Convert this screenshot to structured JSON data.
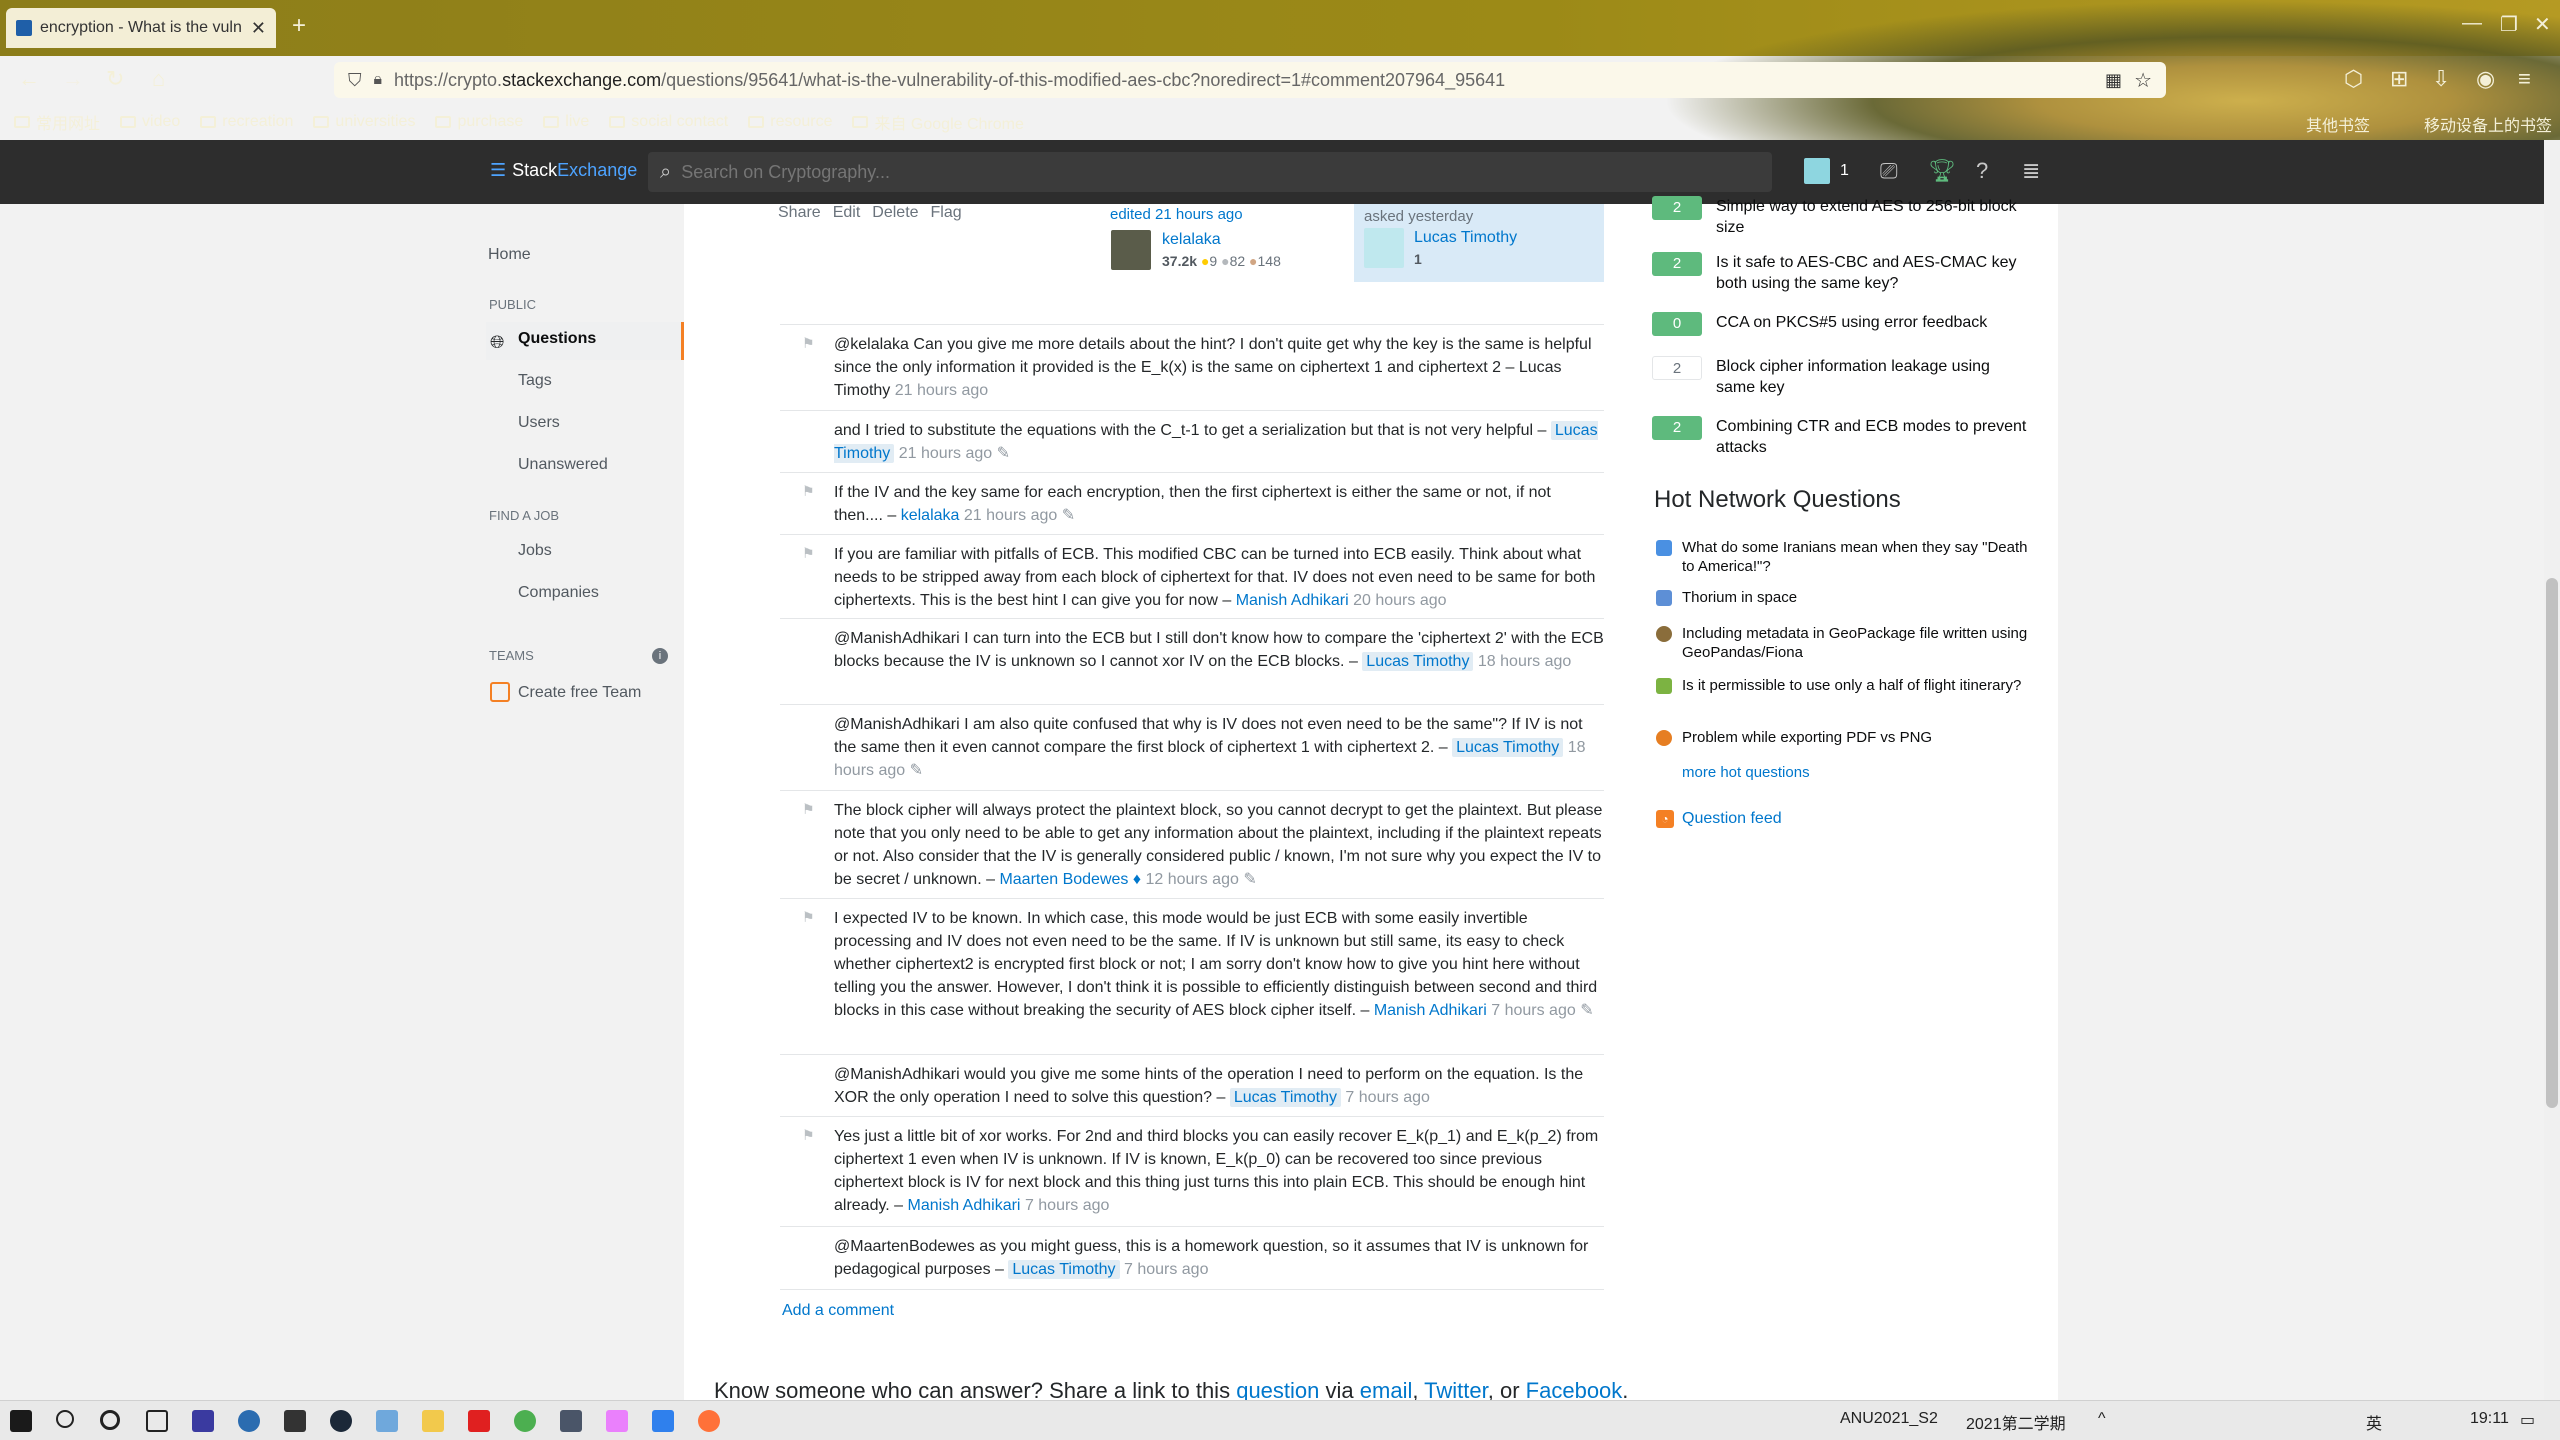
{
  "browser": {
    "tab_title": "encryption - What is the vuln",
    "url_prefix": "https://crypto.",
    "url_domain": "stackexchange.com",
    "url_rest": "/questions/95641/what-is-the-vulnerability-of-this-modified-aes-cbc?noredirect=1#comment207964_95641",
    "bookmarks": [
      "常用网址",
      "video",
      "recreation",
      "universities",
      "purchase",
      "live",
      "social contact",
      "resource",
      "来自 Google Chrome"
    ],
    "bookmarks_right": [
      "其他书签",
      "移动设备上的书签"
    ]
  },
  "se": {
    "logo_a": "Stack",
    "logo_b": "Exchange",
    "search_placeholder": "Search on Cryptography...",
    "inbox_count": "1"
  },
  "leftnav": {
    "home": "Home",
    "public": "PUBLIC",
    "questions": "Questions",
    "tags": "Tags",
    "users": "Users",
    "unanswered": "Unanswered",
    "find_job": "FIND A JOB",
    "jobs": "Jobs",
    "companies": "Companies",
    "teams": "TEAMS",
    "create_team": "Create free Team"
  },
  "post": {
    "share": "Share",
    "edit": "Edit",
    "delete": "Delete",
    "flag": "Flag",
    "edited": "edited 21 hours ago",
    "editor": "kelalaka",
    "editor_rep": "37.2k",
    "editor_gold": "9",
    "editor_silver": "82",
    "editor_bronze": "148",
    "asked": "asked yesterday",
    "asker": "Lucas Timothy",
    "asker_rep": "1"
  },
  "comments": [
    {
      "text": "@kelalaka Can you give me more details about the hint? I don't quite get why the key is the same is helpful since the only information it provided is the E_k(x) is the same on ciphertext 1 and ciphertext 2 –",
      "user": "Lucas Timothy",
      "date": "21 hours ago"
    },
    {
      "text": "and I tried to substitute the equations with the C_t-1 to get a serialization but that is not very helpful –",
      "user": "Lucas Timothy",
      "date": "21 hours ago"
    },
    {
      "text": "If the IV and the key same for each encryption, then the first ciphertext is either the same or not, if not then.... –",
      "user": "kelalaka",
      "date": "21 hours ago"
    },
    {
      "text": "If you are familiar with pitfalls of ECB. This modified CBC can be turned into ECB easily. Think about what needs to be stripped away from each block of ciphertext for that. IV does not even need to be same for both ciphertexts. This is the best hint I can give you for now –",
      "user": "Manish Adhikari",
      "date": "20 hours ago"
    },
    {
      "text": "@ManishAdhikari I can turn into the ECB but I still don't know how to compare the 'ciphertext 2' with the ECB blocks because the IV is unknown so I cannot xor IV on the ECB blocks. –",
      "user": "Lucas Timothy",
      "date": "18 hours ago"
    },
    {
      "text": "@ManishAdhikari I am also quite confused that why is IV does not even need to be the same\"? If IV is not the same then it even cannot compare the first block of ciphertext 1 with ciphertext 2. –",
      "user": "Lucas Timothy",
      "date": "18 hours ago"
    },
    {
      "text": "The block cipher will always protect the plaintext block, so you cannot decrypt to get the plaintext. But please note that you only need to be able to get any information about the plaintext, including if the plaintext repeats or not. Also consider that the IV is generally considered public / known, I'm not sure why you expect the IV to be secret / unknown. –",
      "user": "Maarten Bodewes ♦",
      "date": "12 hours ago"
    },
    {
      "text": "I expected IV to be known. In which case, this mode would be just ECB with some easily invertible processing and IV does not even need to be the same. If IV is unknown but still same, its easy to check whether ciphertext2 is encrypted first block or not; I am sorry don't know how to give you hint here without telling you the answer. However, I don't think it is possible to efficiently distinguish between second and third blocks in this case without breaking the security of AES block cipher itself. –",
      "user": "Manish Adhikari",
      "date": "7 hours ago"
    },
    {
      "text": "@ManishAdhikari would you give me some hints of the operation I need to perform on the equation. Is the XOR the only operation I need to solve this question? –",
      "user": "Lucas Timothy",
      "date": "7 hours ago"
    },
    {
      "text": "Yes just a little bit of xor works. For 2nd and third blocks you can easily recover E_k(p_1) and E_k(p_2) from ciphertext 1 even when IV is unknown. If IV is known, E_k(p_0) can be recovered too since previous ciphertext block is IV for next block and this thing just turns this into plain ECB. This should be enough hint already. –",
      "user": "Manish Adhikari",
      "date": "7 hours ago"
    },
    {
      "text": "@MaartenBodewes as you might guess, this is a homework question, so it assumes that IV is unknown for pedagogical purposes –",
      "user": "Lucas Timothy",
      "date": "7 hours ago"
    }
  ],
  "add_comment": "Add a comment",
  "share": {
    "prefix": "Know someone who can answer? Share a link to this",
    "question": "question",
    "via": "via",
    "email": "email",
    "twitter": "Twitter",
    "or": ", or",
    "facebook": "Facebook"
  },
  "related": [
    {
      "score": "2",
      "title": "Simple way to extend AES to 256-bit block size"
    },
    {
      "score": "2",
      "title": "Is it safe to AES-CBC and AES-CMAC key both using the same key?"
    },
    {
      "score": "0",
      "title": "CCA on PKCS#5 using error feedback"
    },
    {
      "score": "2",
      "title": "Block cipher information leakage using same key"
    },
    {
      "score": "2",
      "title": "Combining CTR and ECB modes to prevent attacks"
    }
  ],
  "hnq": {
    "title": "Hot Network Questions",
    "items": [
      "What do some Iranians mean when they say \"Death to America!\"?",
      "Thorium in space",
      "Including metadata in GeoPackage file written using GeoPandas/Fiona",
      "Is it permissible to use only a half of flight itinerary?",
      "Problem while exporting PDF vs PNG"
    ],
    "more": "more hot questions",
    "feed": "Question feed"
  },
  "taskbar": {
    "label1": "ANU2021_S2",
    "label2": "2021第二学期",
    "ime": "英",
    "time": "19:11"
  },
  "colors": {
    "accent": "#f48024",
    "link": "#0077cc",
    "score_green": "#5eba7d"
  }
}
